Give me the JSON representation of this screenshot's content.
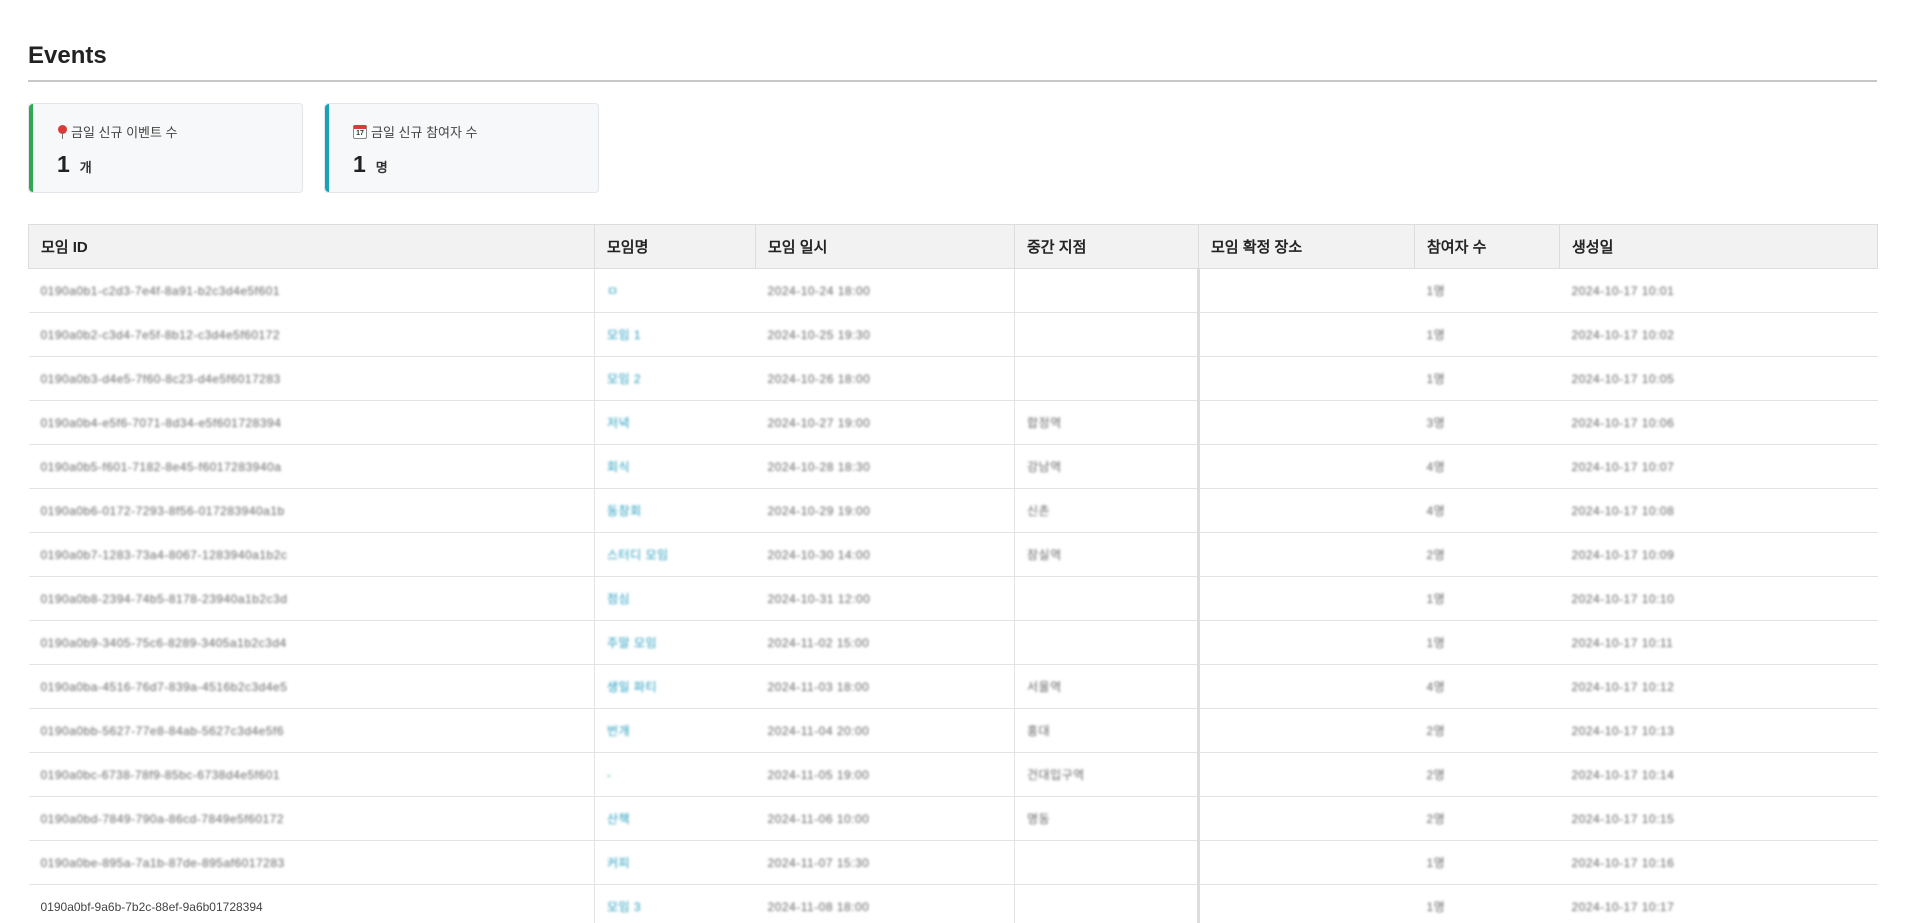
{
  "page": {
    "title": "Events"
  },
  "stats": {
    "new_events": {
      "label": "금일 신규 이벤트 수",
      "value": "1",
      "unit": "개",
      "icon": "pin-icon",
      "accent": "#2fa84f"
    },
    "new_participants": {
      "label": "금일 신규 참여자 수",
      "value": "1",
      "unit": "명",
      "icon": "calendar-icon",
      "calendar_text": "17",
      "accent": "#17a2b8"
    }
  },
  "table": {
    "columns": [
      "모임 ID",
      "모임명",
      "모임 일시",
      "중간 지점",
      "모임 확정 장소",
      "참여자 수",
      "생성일"
    ],
    "rows": [
      {
        "id": "0190a0b1-c2d3-7e4f-8a91-b2c3d4e5f601",
        "name": "ㅁ",
        "date": "2024-10-24 18:00",
        "midpoint": "",
        "place": "",
        "count": "1명",
        "created": "2024-10-17 10:01"
      },
      {
        "id": "0190a0b2-c3d4-7e5f-8b12-c3d4e5f60172",
        "name": "모임 1",
        "date": "2024-10-25 19:30",
        "midpoint": "",
        "place": "",
        "count": "1명",
        "created": "2024-10-17 10:02"
      },
      {
        "id": "0190a0b3-d4e5-7f60-8c23-d4e5f6017283",
        "name": "모임 2",
        "date": "2024-10-26 18:00",
        "midpoint": "",
        "place": "",
        "count": "1명",
        "created": "2024-10-17 10:05"
      },
      {
        "id": "0190a0b4-e5f6-7071-8d34-e5f601728394",
        "name": "저녁",
        "date": "2024-10-27 19:00",
        "midpoint": "합정역",
        "place": "",
        "count": "3명",
        "created": "2024-10-17 10:06"
      },
      {
        "id": "0190a0b5-f601-7182-8e45-f6017283940a",
        "name": "회식",
        "date": "2024-10-28 18:30",
        "midpoint": "강남역",
        "place": "",
        "count": "4명",
        "created": "2024-10-17 10:07"
      },
      {
        "id": "0190a0b6-0172-7293-8f56-017283940a1b",
        "name": "동창회",
        "date": "2024-10-29 19:00",
        "midpoint": "신촌",
        "place": "",
        "count": "4명",
        "created": "2024-10-17 10:08"
      },
      {
        "id": "0190a0b7-1283-73a4-8067-1283940a1b2c",
        "name": "스터디 모임",
        "date": "2024-10-30 14:00",
        "midpoint": "잠실역",
        "place": "",
        "count": "2명",
        "created": "2024-10-17 10:09"
      },
      {
        "id": "0190a0b8-2394-74b5-8178-23940a1b2c3d",
        "name": "점심",
        "date": "2024-10-31 12:00",
        "midpoint": "",
        "place": "",
        "count": "1명",
        "created": "2024-10-17 10:10"
      },
      {
        "id": "0190a0b9-3405-75c6-8289-3405a1b2c3d4",
        "name": "주말 모임",
        "date": "2024-11-02 15:00",
        "midpoint": "",
        "place": "",
        "count": "1명",
        "created": "2024-10-17 10:11"
      },
      {
        "id": "0190a0ba-4516-76d7-839a-4516b2c3d4e5",
        "name": "생일 파티",
        "date": "2024-11-03 18:00",
        "midpoint": "서울역",
        "place": "",
        "count": "4명",
        "created": "2024-10-17 10:12"
      },
      {
        "id": "0190a0bb-5627-77e8-84ab-5627c3d4e5f6",
        "name": "번개",
        "date": "2024-11-04 20:00",
        "midpoint": "홍대",
        "place": "",
        "count": "2명",
        "created": "2024-10-17 10:13"
      },
      {
        "id": "0190a0bc-6738-78f9-85bc-6738d4e5f601",
        "name": "-",
        "date": "2024-11-05 19:00",
        "midpoint": "건대입구역",
        "place": "",
        "count": "2명",
        "created": "2024-10-17 10:14"
      },
      {
        "id": "0190a0bd-7849-790a-86cd-7849e5f60172",
        "name": "산책",
        "date": "2024-11-06 10:00",
        "midpoint": "명동",
        "place": "",
        "count": "2명",
        "created": "2024-10-17 10:15"
      },
      {
        "id": "0190a0be-895a-7a1b-87de-895af6017283",
        "name": "커피",
        "date": "2024-11-07 15:30",
        "midpoint": "",
        "place": "",
        "count": "1명",
        "created": "2024-10-17 10:16"
      },
      {
        "id": "0190a0bf-9a6b-7b2c-88ef-9a6b01728394",
        "name": "모임 3",
        "date": "2024-11-08 18:00",
        "midpoint": "",
        "place": "",
        "count": "1명",
        "created": "2024-10-17 10:17"
      }
    ]
  }
}
